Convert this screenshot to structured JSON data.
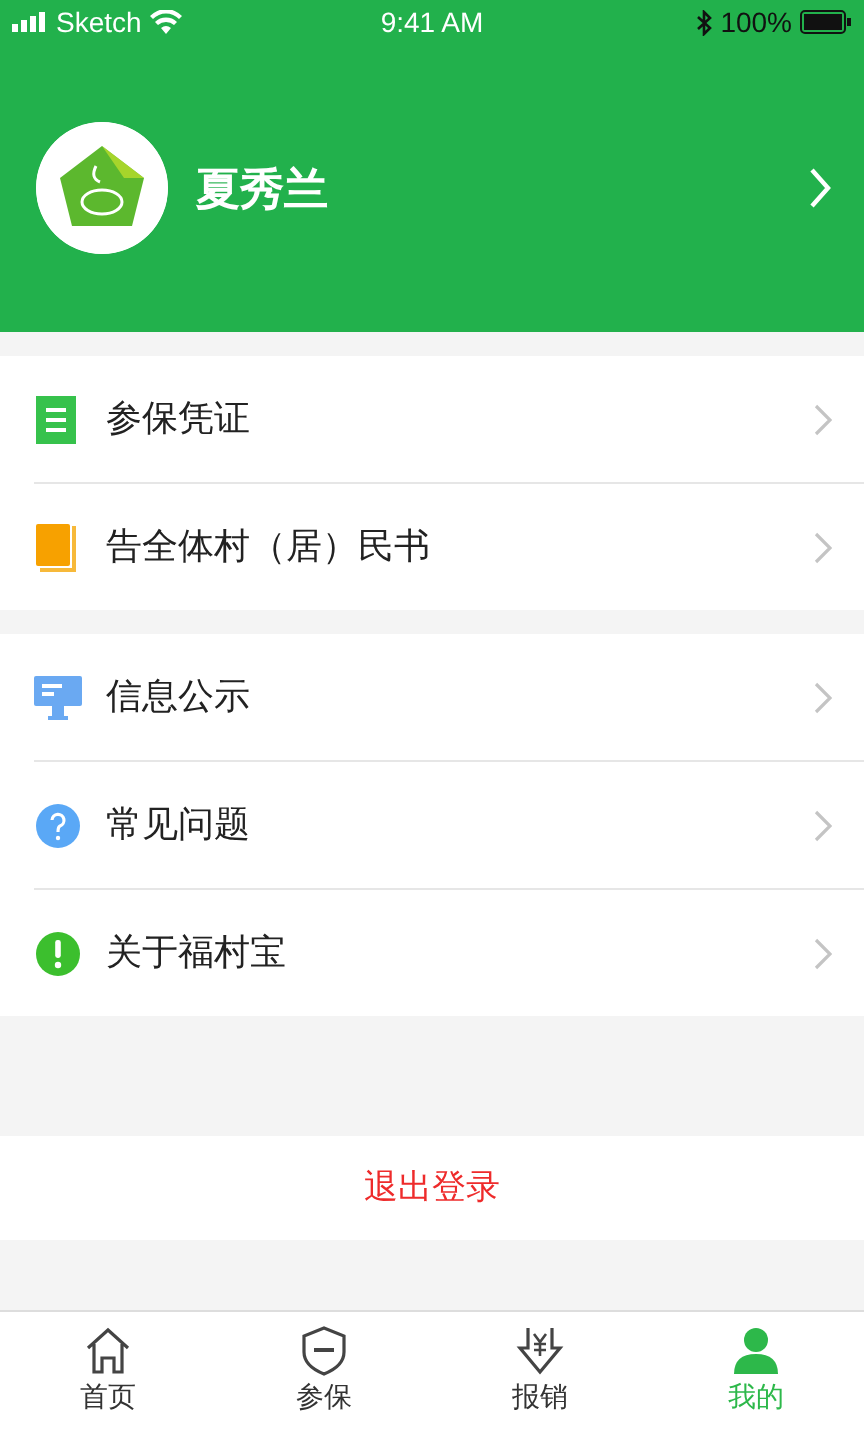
{
  "status_bar": {
    "carrier": "Sketch",
    "time": "9:41 AM",
    "battery": "100%"
  },
  "profile": {
    "name": "夏秀兰"
  },
  "menu_groups": [
    [
      {
        "label": "参保凭证"
      },
      {
        "label": "告全体村（居）民书"
      }
    ],
    [
      {
        "label": "信息公示"
      },
      {
        "label": "常见问题"
      },
      {
        "label": "关于福村宝"
      }
    ]
  ],
  "logout": {
    "label": "退出登录"
  },
  "tabs": [
    {
      "label": "首页",
      "selected": false
    },
    {
      "label": "参保",
      "selected": false
    },
    {
      "label": "报销",
      "selected": false
    },
    {
      "label": "我的",
      "selected": true
    }
  ]
}
